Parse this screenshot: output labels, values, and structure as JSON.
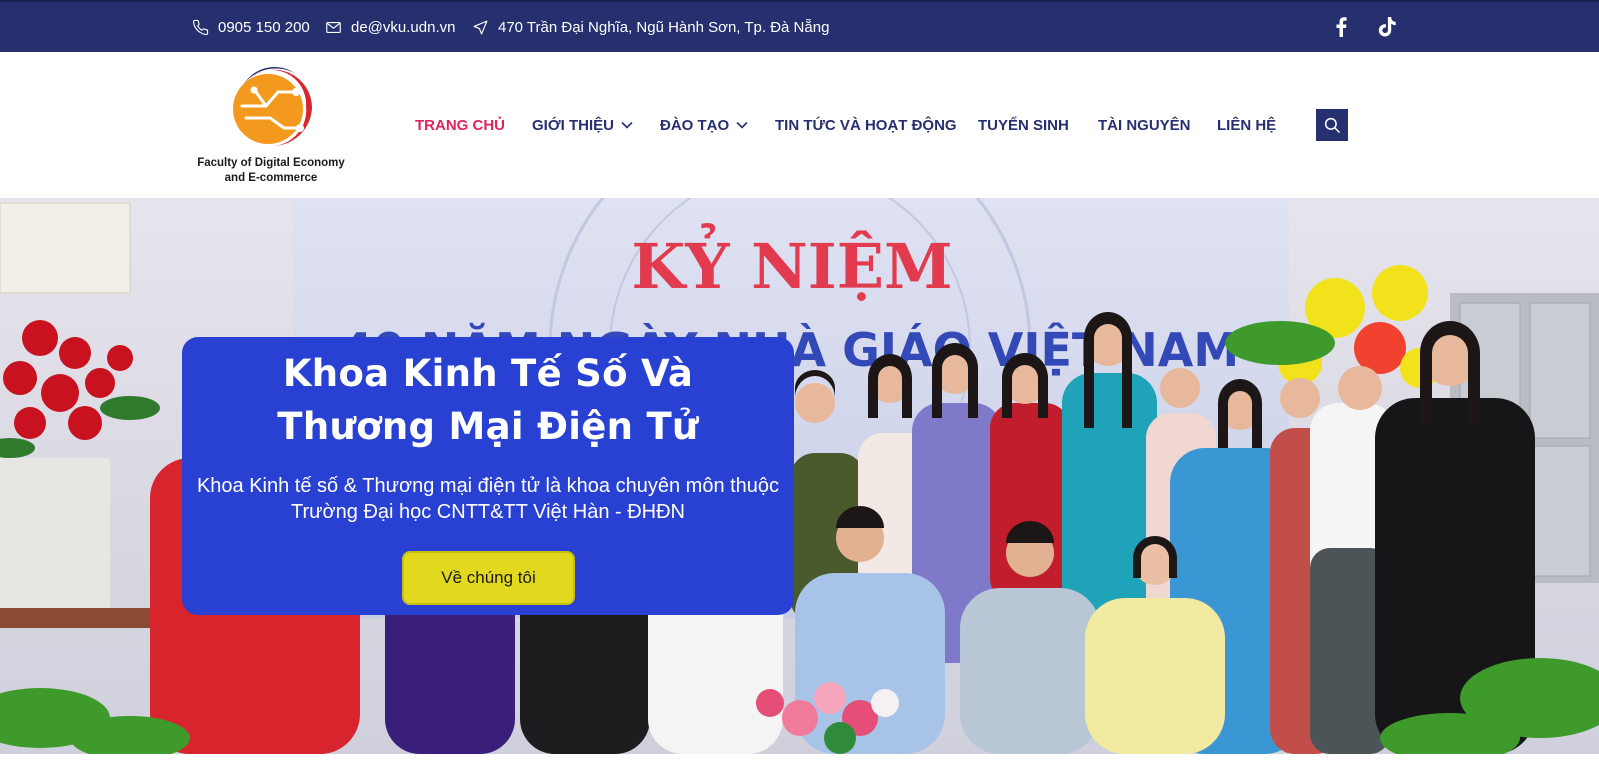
{
  "topbar": {
    "phone": "0905 150 200",
    "email": "de@vku.udn.vn",
    "address": "470 Trần Đại Nghĩa, Ngũ Hành Sơn, Tp. Đà Nẵng",
    "phone_icon": "phone-icon",
    "email_icon": "envelope-icon",
    "address_icon": "navigation-arrow-icon",
    "social": [
      "facebook-icon",
      "tiktok-icon"
    ]
  },
  "logo": {
    "text_line1": "Faculty of Digital Economy",
    "text_line2": "and E-commerce"
  },
  "nav": {
    "items": [
      {
        "label": "TRANG CHỦ",
        "active": true
      },
      {
        "label": "GIỚI THIỆU",
        "dropdown": true
      },
      {
        "label": "ĐÀO TẠO",
        "dropdown": true
      },
      {
        "label": "TIN TỨC VÀ HOẠT ĐỘNG"
      },
      {
        "label": "TUYỂN SINH"
      },
      {
        "label": "TÀI NGUYÊN"
      },
      {
        "label": "LIÊN HỆ"
      }
    ],
    "search_icon": "search-icon"
  },
  "hero": {
    "title_line1": "Khoa Kinh Tế Số Và",
    "title_line2": "Thương Mại Điện Tử",
    "desc_line1": "Khoa Kinh tế số & Thương mại điện tử là khoa chuyên môn thuộc",
    "desc_line2": "Trường Đại học CNTT&TT Việt Hàn - ĐHĐN",
    "button_label": "Về chúng tôi",
    "banner_line1": "KỶ NIỆM",
    "banner_line2": "40 NĂM NGÀY NHÀ GIÁO VIỆT NAM"
  },
  "colors": {
    "topbar_bg": "#27306e",
    "nav_text": "#27306e",
    "nav_active": "#e0245e",
    "card_bg": "#2941d3",
    "button_bg": "#e2d81d"
  }
}
